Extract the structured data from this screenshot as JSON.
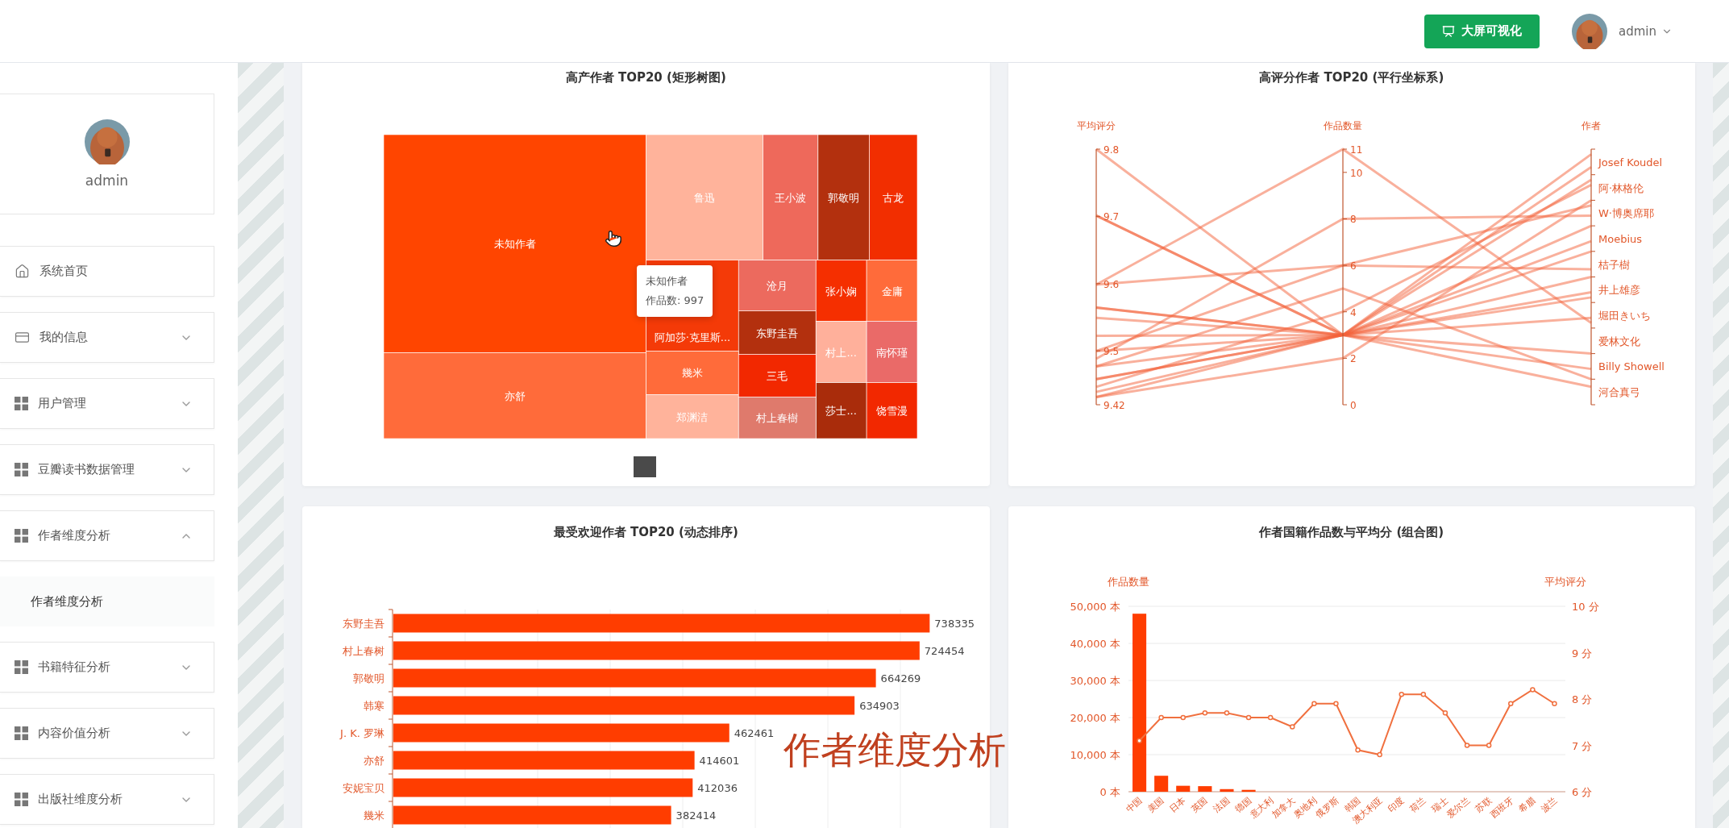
{
  "header": {
    "action_button": "大屏可视化",
    "user": {
      "name": "admin"
    }
  },
  "sidebar": {
    "profile": {
      "name": "admin"
    },
    "menu": [
      {
        "label": "系统首页",
        "kind": "home"
      },
      {
        "label": "我的信息",
        "kind": "profile",
        "expanded": false
      },
      {
        "label": "用户管理",
        "kind": "module",
        "expanded": false
      },
      {
        "label": "豆瓣读书数据管理",
        "kind": "module",
        "expanded": false
      },
      {
        "label": "作者维度分析",
        "kind": "module",
        "expanded": true,
        "children": [
          {
            "label": "作者维度分析",
            "selected": true
          }
        ]
      },
      {
        "label": "书籍特征分析",
        "kind": "module",
        "expanded": false
      },
      {
        "label": "内容价值分析",
        "kind": "module",
        "expanded": false
      },
      {
        "label": "出版社维度分析",
        "kind": "module",
        "expanded": false
      }
    ]
  },
  "panels": [
    {
      "kind": "treemap",
      "title": "高产作者 TOP20 (矩形树图)",
      "items": [
        {
          "name": "未知作者",
          "color": "#ff4500"
        },
        {
          "name": "亦舒",
          "color": "#ff6b3a"
        },
        {
          "name": "鲁迅",
          "color": "#ffb39b"
        },
        {
          "name": "王小波",
          "color": "#ee695b"
        },
        {
          "name": "郭敬明",
          "color": "#b3300e"
        },
        {
          "name": "古龙",
          "color": "#f22e00"
        },
        {
          "name": "阿加莎·克里斯...",
          "color": "#f43a08"
        },
        {
          "name": "沧月",
          "color": "#ec6a5e"
        },
        {
          "name": "东野圭吾",
          "color": "#b3300e"
        },
        {
          "name": "张小娴",
          "color": "#f52f00"
        },
        {
          "name": "金庸",
          "color": "#ff6b3a"
        },
        {
          "name": "村上...",
          "color": "#ffb09b"
        },
        {
          "name": "南怀瑾",
          "color": "#ea6a68"
        },
        {
          "name": "莎士...",
          "color": "#a92c0b"
        },
        {
          "name": "饶雪漫",
          "color": "#f22800"
        },
        {
          "name": "幾米",
          "color": "#ff6b3a"
        },
        {
          "name": "郑渊洁",
          "color": "#ffb39b"
        },
        {
          "name": "三毛",
          "color": "#f22800"
        },
        {
          "name": "村上春樹",
          "color": "#df7a6c"
        }
      ],
      "tooltip": {
        "title": "未知作者",
        "text": "作品数: 997"
      }
    },
    {
      "kind": "parallel",
      "title": "高评分作者 TOP20 (平行坐标系)",
      "axes": [
        {
          "name": "平均评分",
          "ticks": [
            "9.8",
            "9.7",
            "9.6",
            "9.5",
            "9.42"
          ]
        },
        {
          "name": "作品数量",
          "ticks": [
            "11",
            "10",
            "8",
            "6",
            "4",
            "2",
            "0"
          ]
        },
        {
          "name": "作者",
          "ticks": [
            "Josef Koudel",
            "阿·林格伦",
            "W·博奥席耶",
            "Moebius",
            "桔子樹",
            "井上雄彦",
            "堀田きいち",
            "爱林文化",
            "Billy Showell",
            "河合真弓"
          ]
        }
      ]
    },
    {
      "kind": "hbar",
      "title": "最受欢迎作者 TOP20 (动态排序)",
      "chart_data": {
        "type": "bar",
        "orientation": "horizontal",
        "categories": [
          "东野圭吾",
          "村上春树",
          "郭敬明",
          "韩寒",
          "J. K. 罗琳",
          "亦舒",
          "安妮宝贝",
          "幾米"
        ],
        "series": [
          {
            "color": "#ff3d00",
            "values": [
              738335,
              724454,
              664269,
              634903,
              462461,
              414601,
              412036,
              382414
            ]
          }
        ],
        "data_labels": true
      }
    },
    {
      "kind": "combo",
      "title": "作者国籍作品数与平均分 (组合图)",
      "chart_data": {
        "type": "bar",
        "categories": [
          "中国",
          "美国",
          "日本",
          "英国",
          "法国",
          "德国",
          "意大利",
          "加拿大",
          "奥地利",
          "俄罗斯",
          "韩国",
          "澳大利亚",
          "印度",
          "荷兰",
          "瑞士",
          "爱尔兰",
          "苏联",
          "西班牙",
          "希腊",
          "波兰"
        ],
        "series": [
          {
            "type": "bar",
            "color": "#ff3d00",
            "values": [
              48000,
              4300,
              1600,
              1500,
              700,
              500,
              null,
              0,
              0,
              0,
              0,
              0,
              0,
              0,
              0,
              0,
              0,
              0,
              0,
              0
            ]
          },
          {
            "type": "line",
            "color": "#f0703f",
            "axis": "y2",
            "marker": true,
            "values": [
              7.1,
              7.6,
              7.6,
              7.7,
              7.7,
              7.6,
              7.6,
              7.4,
              7.9,
              7.9,
              6.9,
              6.8,
              8.1,
              8.1,
              7.7,
              7.0,
              7.0,
              7.9,
              8.2,
              7.9
            ]
          }
        ],
        "grid": true,
        "ylabel": "作品数量",
        "ylim": [
          0,
          50000
        ],
        "yticks": [
          {
            "value": 0,
            "label": "0 本"
          },
          {
            "value": 10000,
            "label": "10,000 本"
          },
          {
            "value": 20000,
            "label": "20,000 本"
          },
          {
            "value": 30000,
            "label": "30,000 本"
          },
          {
            "value": 40000,
            "label": "40,000 本"
          },
          {
            "value": 50000,
            "label": "50,000 本"
          }
        ],
        "y2label": "平均评分",
        "y2lim": [
          6,
          10
        ],
        "y2ticks": [
          {
            "value": 6,
            "label": "6 分"
          },
          {
            "value": 7,
            "label": "7 分"
          },
          {
            "value": 8,
            "label": "8 分"
          },
          {
            "value": 9,
            "label": "9 分"
          },
          {
            "value": 10,
            "label": "10 分"
          }
        ]
      }
    }
  ],
  "overlay_caption": "作者维度分析"
}
